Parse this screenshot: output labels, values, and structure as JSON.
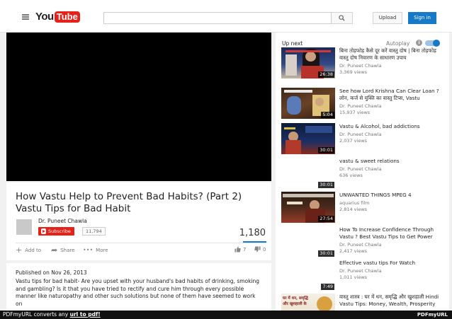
{
  "header": {
    "logo_you": "You",
    "logo_tube": "Tube",
    "search_placeholder": "",
    "upload_label": "Upload",
    "signin_label": "Sign in"
  },
  "video": {
    "title": "How Vastu Help to Prevent Bad Habits? (Part 2) Vastu Tips for Bad Habit",
    "channel": "Dr. Puneet Chawla",
    "subscribe_label": "Subscribe",
    "subscriber_count": "11,794",
    "view_count": "1,180",
    "add_to_label": "Add to",
    "share_label": "Share",
    "more_label": "More",
    "likes": "7",
    "dislikes": "0"
  },
  "description": {
    "published": "Published on Nov 26, 2013",
    "text": "Vastu tips for bad habit- Are you upset with your husband's bad habits of drinking, smoking and gambling? Is it that you have tried to rectify and cure him through every possible manner like naturopathy and other such solutions but none of them have seemed to work on"
  },
  "sidebar": {
    "up_next": "Up next",
    "autoplay": "Autoplay",
    "items": [
      {
        "title": "बिना तोड़फोड़ कैसे दूर करें वास्तु दोष | बिना तोड़फोड़ वास्तु दोष निवारण के साधारण उपाय",
        "channel": "Dr. Puneet Chawla",
        "views": "3,369 views",
        "duration": "26:38"
      },
      {
        "title": "See how Lord Krishna Can Clear Loan ? लोन, कर्ज से मुक्ति का वास्तु टिप्स, Vastu",
        "channel": "Dr. Puneet Chawla",
        "views": "15,937 views",
        "duration": "5:04"
      },
      {
        "title": "Vastu & Alcohol, bad addictions",
        "channel": "Dr. Puneet Chawla",
        "views": "2,037 views",
        "duration": "30:01"
      },
      {
        "title": "vastu & sweet relations",
        "channel": "Dr. Puneet Chawla",
        "views": "636 views",
        "duration": "30:01"
      },
      {
        "title": "UNWANTED THINGS MPEG 4",
        "channel": "aquarius film",
        "views": "2,814 views",
        "duration": "27:54"
      },
      {
        "title": "How To Increase Confidence Through Vastu ? Best Vastu Tips to Get Power",
        "channel": "Dr. Puneet Chawla",
        "views": "2,417 views",
        "duration": "30:01"
      },
      {
        "title": "Effective vastu tips For Watch",
        "channel": "Dr. Puneet Chawla",
        "views": "1,011 views",
        "duration": "7:49"
      },
      {
        "title": "वास्तु शास्त्र : घर में धन, समृद्धि और खुशहाली Hindi Vastu Tips: Money, Wealth, Prosperity",
        "channel": "",
        "views": "",
        "duration": ""
      }
    ]
  },
  "thumb_texts": {
    "last": "घर में धन, समृद्धि और खुशहाली के"
  },
  "footer": {
    "prefix": "PDFmyURL converts any",
    "link": "url to pdf!",
    "logo": "PDFmyURL"
  },
  "colors": {
    "brand_red": "#e62117",
    "accent_blue": "#167ac6"
  }
}
